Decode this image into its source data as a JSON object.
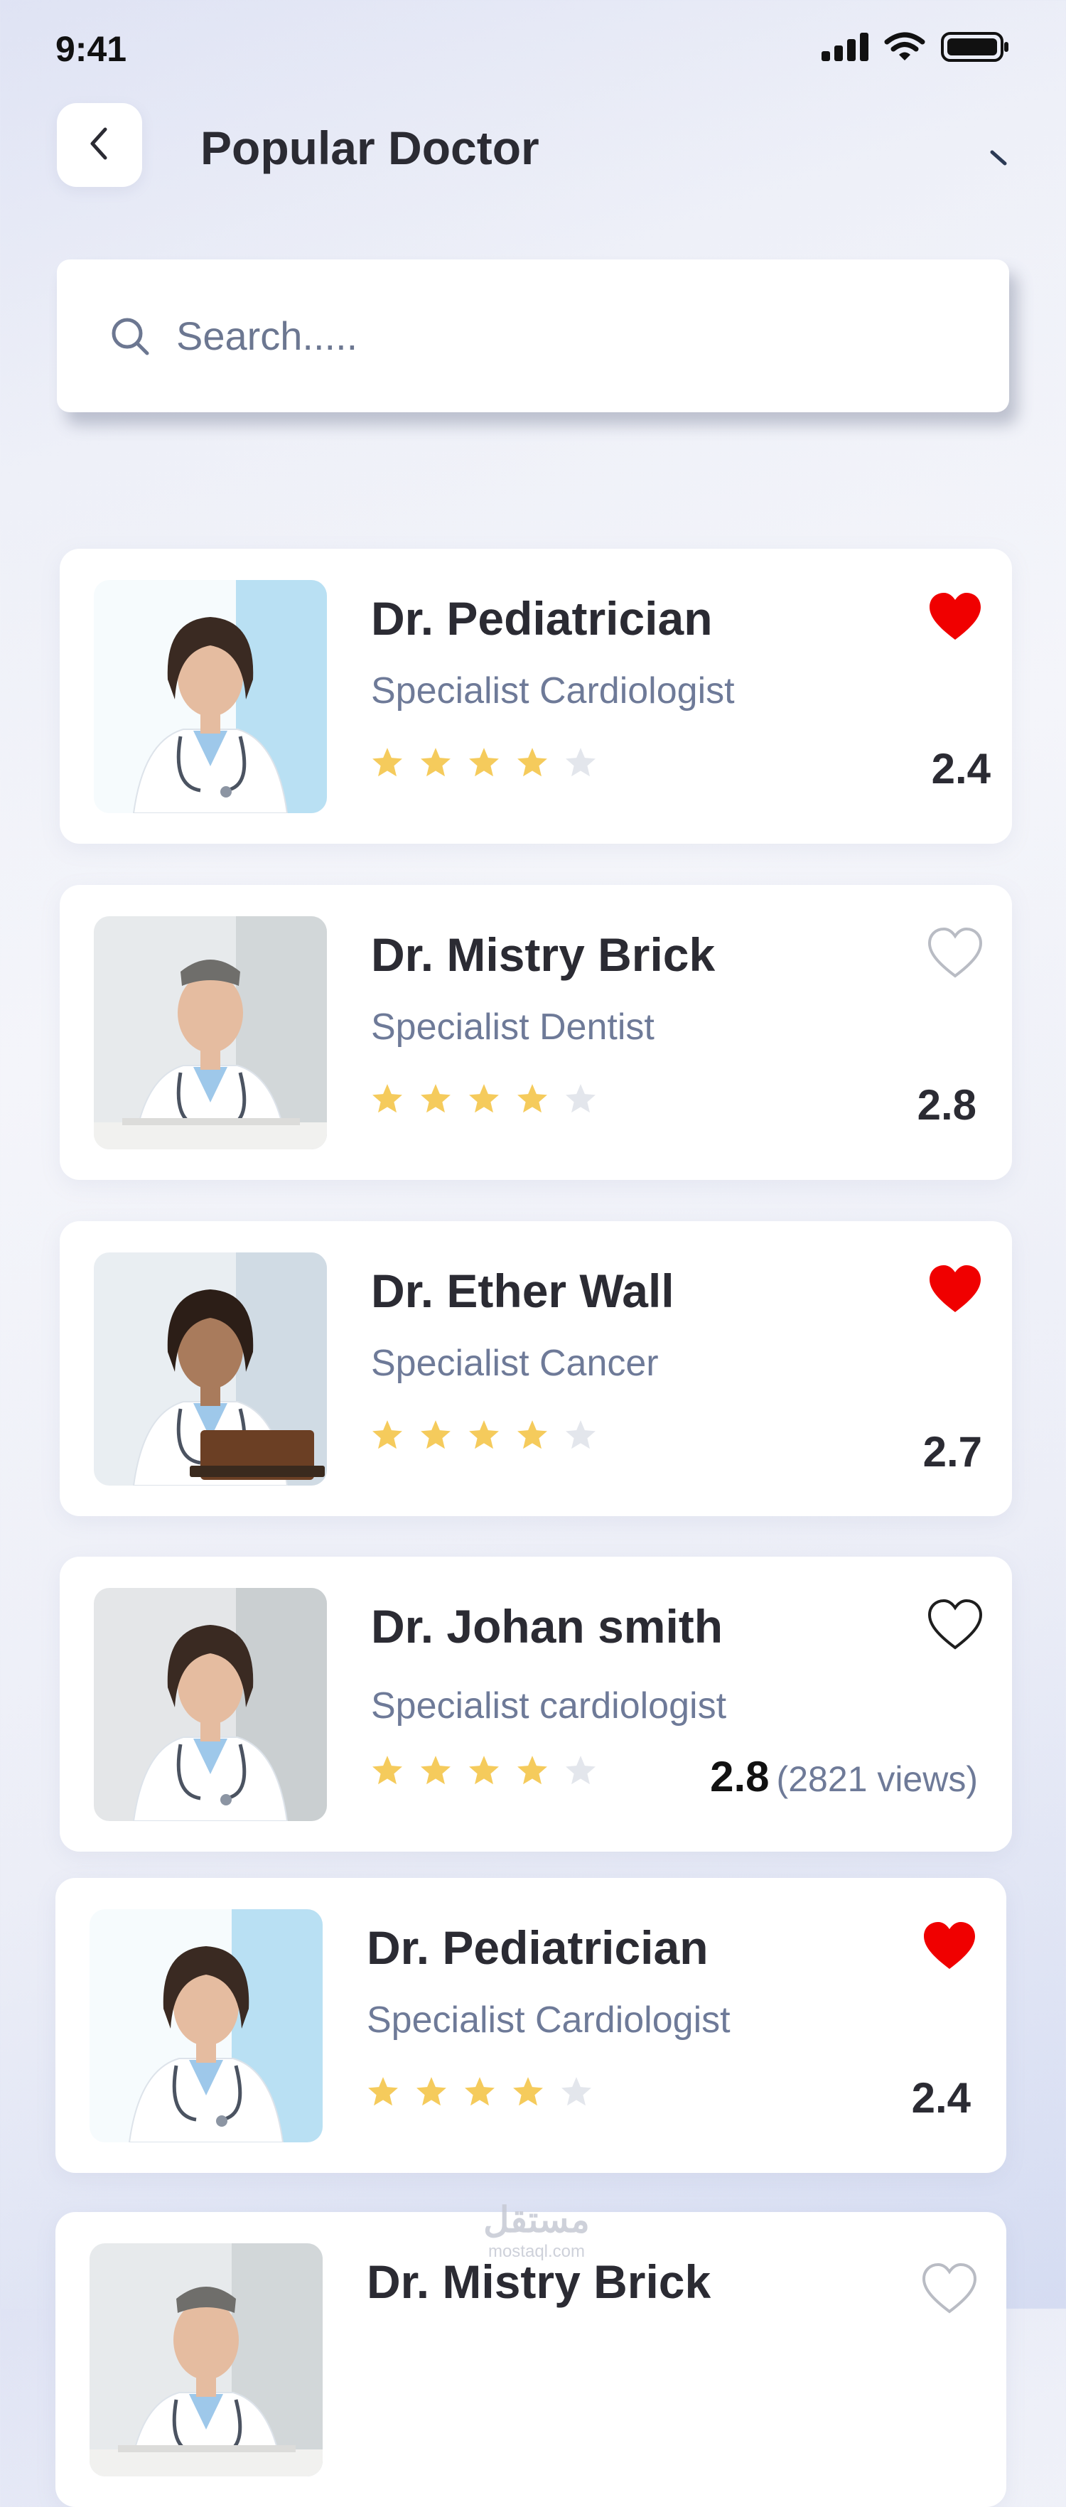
{
  "status_bar": {
    "time": "9:41",
    "icons": [
      "signal-icon",
      "wifi-icon",
      "battery-icon"
    ]
  },
  "header": {
    "title": "Popular Doctor",
    "back_icon": "chevron-left-icon"
  },
  "search": {
    "placeholder": "Search.....",
    "icon": "search-icon"
  },
  "colors": {
    "heart_filled": "#F00000",
    "star_filled": "#F5CB5C",
    "star_empty": "#E3E6EC",
    "title_text": "#2B2B33",
    "subtitle_text": "#6E7A98"
  },
  "doctors": [
    {
      "name": "Dr. Pediatrician",
      "specialty": "Specialist Cardiologist",
      "rating": "2.4",
      "stars": 4,
      "favorite": true
    },
    {
      "name": "Dr. Mistry Brick",
      "specialty": "Specialist Dentist",
      "rating": "2.8",
      "stars": 4,
      "favorite": false
    },
    {
      "name": "Dr. Ether Wall",
      "specialty": "Specialist Cancer",
      "rating": "2.7",
      "stars": 4,
      "favorite": true
    },
    {
      "name": "Dr. Johan smith",
      "specialty": "Specialist cardiologist",
      "rating": "2.8",
      "views": "(2821 views)",
      "stars": 4,
      "favorite": false
    },
    {
      "name": "Dr. Pediatrician",
      "specialty": "Specialist Cardiologist",
      "rating": "2.4",
      "stars": 4,
      "favorite": true
    },
    {
      "name": "Dr. Mistry Brick",
      "specialty": "",
      "rating": "",
      "stars": 0,
      "favorite": false
    }
  ],
  "watermark": {
    "arabic": "مستقل",
    "latin": "mostaql.com"
  }
}
